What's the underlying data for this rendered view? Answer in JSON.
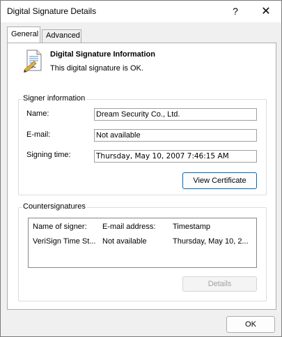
{
  "window": {
    "title": "Digital Signature Details",
    "help_glyph": "?",
    "close_glyph": "✕"
  },
  "tabs": [
    {
      "label": "General",
      "selected": true
    },
    {
      "label": "Advanced",
      "selected": false
    }
  ],
  "info": {
    "title": "Digital Signature Information",
    "status": "This digital signature is OK.",
    "icon": "signed-document-icon"
  },
  "signer": {
    "group_label": "Signer information",
    "name_label": "Name:",
    "name_value": "Dream Security Co., Ltd.",
    "email_label": "E-mail:",
    "email_value": "Not available",
    "time_label": "Signing time:",
    "time_value": "Thursday, May 10, 2007 7:46:15 AM",
    "view_cert_label": "View Certificate"
  },
  "counter": {
    "group_label": "Countersignatures",
    "columns": [
      "Name of signer:",
      "E-mail address:",
      "Timestamp"
    ],
    "rows": [
      [
        "VeriSign Time St...",
        "Not available",
        "Thursday, May 10, 2..."
      ]
    ],
    "details_label": "Details"
  },
  "footer": {
    "ok_label": "OK"
  },
  "colors": {
    "accent": "#0067c0",
    "window_bg": "#f0f0f0",
    "panel_bg": "#ffffff"
  }
}
